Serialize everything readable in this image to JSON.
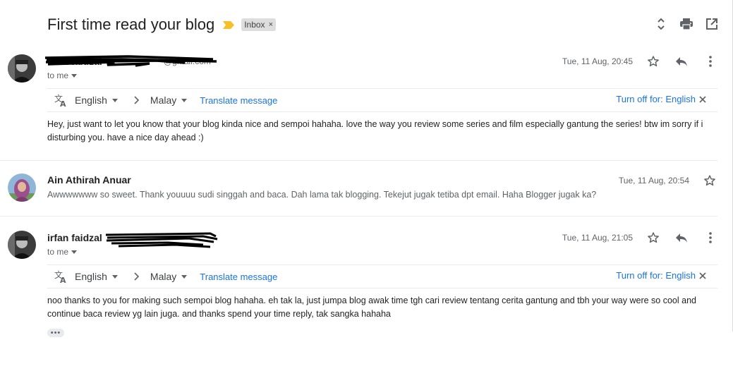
{
  "thread": {
    "subject": "First time read your blog",
    "label": "Inbox",
    "label_remove": "×"
  },
  "toolbar": {
    "icons": [
      "expand-collapse-icon",
      "print-icon",
      "open-new-window-icon"
    ]
  },
  "messages": [
    {
      "sender": "irfan faidzal",
      "email_fragment": "@gmail.com",
      "recipient": "to me",
      "date": "Tue, 11 Aug, 20:45",
      "translate": {
        "from_lang": "English",
        "to_lang": "Malay",
        "translate_link": "Translate message",
        "turn_off": "Turn off for: English"
      },
      "body": "Hey, just want to let you know that your blog kinda nice and sempoi hahaha. love the way you review some series and film especially gantung the series! btw im sorry if i disturbing you. have a nice day ahead :)"
    },
    {
      "sender": "Ain Athirah Anuar",
      "date": "Tue, 11 Aug, 20:54",
      "snippet": "Awwwwwww so sweet. Thank youuuu sudi singgah and baca. Dah lama tak blogging. Tekejut jugak tetiba dpt email. Haha Blogger jugak ka?"
    },
    {
      "sender": "irfan faidzal",
      "recipient": "to me",
      "date": "Tue, 11 Aug, 21:05",
      "translate": {
        "from_lang": "English",
        "to_lang": "Malay",
        "translate_link": "Translate message",
        "turn_off": "Turn off for: English"
      },
      "body": "noo thanks to you for making such sempoi blog hahaha. eh tak la, just jumpa blog awak time tgh cari review tentang cerita gantung and tbh your way were so cool and continue baca review yg lain juga. and thanks spend your time reply, tak sangka hahaha"
    }
  ],
  "colors": {
    "link": "#1a73e8",
    "importance_marker": "#f6c026",
    "label_chip": "#dddddd"
  }
}
